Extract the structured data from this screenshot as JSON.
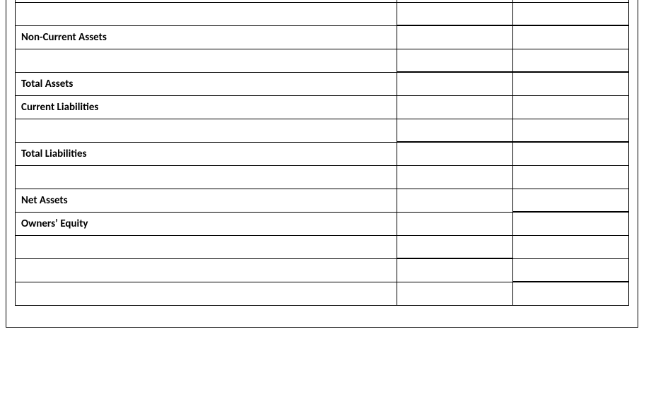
{
  "rows": [
    {
      "label": "",
      "v1": "",
      "v2": "",
      "bold": false,
      "thick": [
        false,
        false,
        false
      ]
    },
    {
      "label": "",
      "v1": "",
      "v2": "",
      "bold": false,
      "thick": [
        false,
        false,
        false
      ]
    },
    {
      "label": "Non-Current Assets",
      "v1": "",
      "v2": "",
      "bold": true,
      "thick": [
        false,
        true,
        true
      ]
    },
    {
      "label": "",
      "v1": "",
      "v2": "",
      "bold": false,
      "thick": [
        false,
        false,
        false
      ]
    },
    {
      "label": "Total Assets",
      "v1": "",
      "v2": "",
      "bold": true,
      "thick": [
        false,
        true,
        true
      ]
    },
    {
      "label": "Current Liabilities",
      "v1": "",
      "v2": "",
      "bold": true,
      "thick": [
        false,
        false,
        false
      ]
    },
    {
      "label": "",
      "v1": "",
      "v2": "",
      "bold": false,
      "thick": [
        false,
        false,
        false
      ]
    },
    {
      "label": "Total Liabilities",
      "v1": "",
      "v2": "",
      "bold": true,
      "thick": [
        false,
        true,
        true
      ]
    },
    {
      "label": "",
      "v1": "",
      "v2": "",
      "bold": false,
      "thick": [
        false,
        false,
        false
      ]
    },
    {
      "label": "Net Assets",
      "v1": "",
      "v2": "",
      "bold": true,
      "thick": [
        false,
        false,
        false
      ]
    },
    {
      "label": "Owners’ Equity",
      "v1": "",
      "v2": "",
      "bold": true,
      "thick": [
        false,
        false,
        true
      ]
    },
    {
      "label": "",
      "v1": "",
      "v2": "",
      "bold": false,
      "thick": [
        false,
        false,
        false
      ]
    },
    {
      "label": "",
      "v1": "",
      "v2": "",
      "bold": false,
      "thick": [
        false,
        true,
        false
      ]
    },
    {
      "label": "",
      "v1": "",
      "v2": "",
      "bold": false,
      "thick": [
        false,
        false,
        true
      ]
    }
  ]
}
